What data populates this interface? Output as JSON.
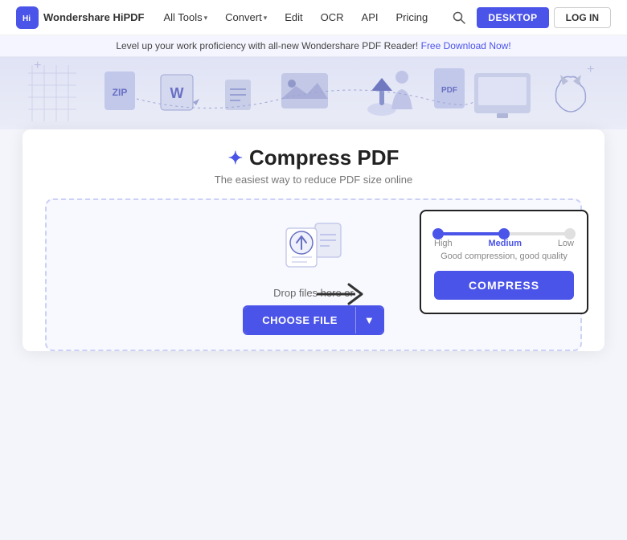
{
  "brand": {
    "logo_text": "Wondershare HiPDF",
    "logo_abbr": "Hi"
  },
  "nav": {
    "items": [
      {
        "label": "All Tools",
        "has_chevron": true
      },
      {
        "label": "Convert",
        "has_chevron": true
      },
      {
        "label": "Edit",
        "has_chevron": false
      },
      {
        "label": "OCR",
        "has_chevron": false
      },
      {
        "label": "API",
        "has_chevron": false
      },
      {
        "label": "Pricing",
        "has_chevron": false
      }
    ],
    "desktop_btn": "DESKTOP",
    "login_btn": "LOG IN"
  },
  "promo": {
    "text": "Level up your work proficiency with all-new Wondershare PDF Reader!",
    "link_text": "Free Download Now!"
  },
  "hero": {
    "title": "Compress PDF",
    "subtitle": "The easiest way to reduce PDF size online"
  },
  "dropzone": {
    "drop_text": "Drop files here or",
    "choose_label": "CHOOSE FILE"
  },
  "compression": {
    "levels": [
      "High",
      "Medium",
      "Low"
    ],
    "active": "Medium",
    "quality_note": "Good compression, good quality",
    "compress_btn": "COMPRESS"
  }
}
